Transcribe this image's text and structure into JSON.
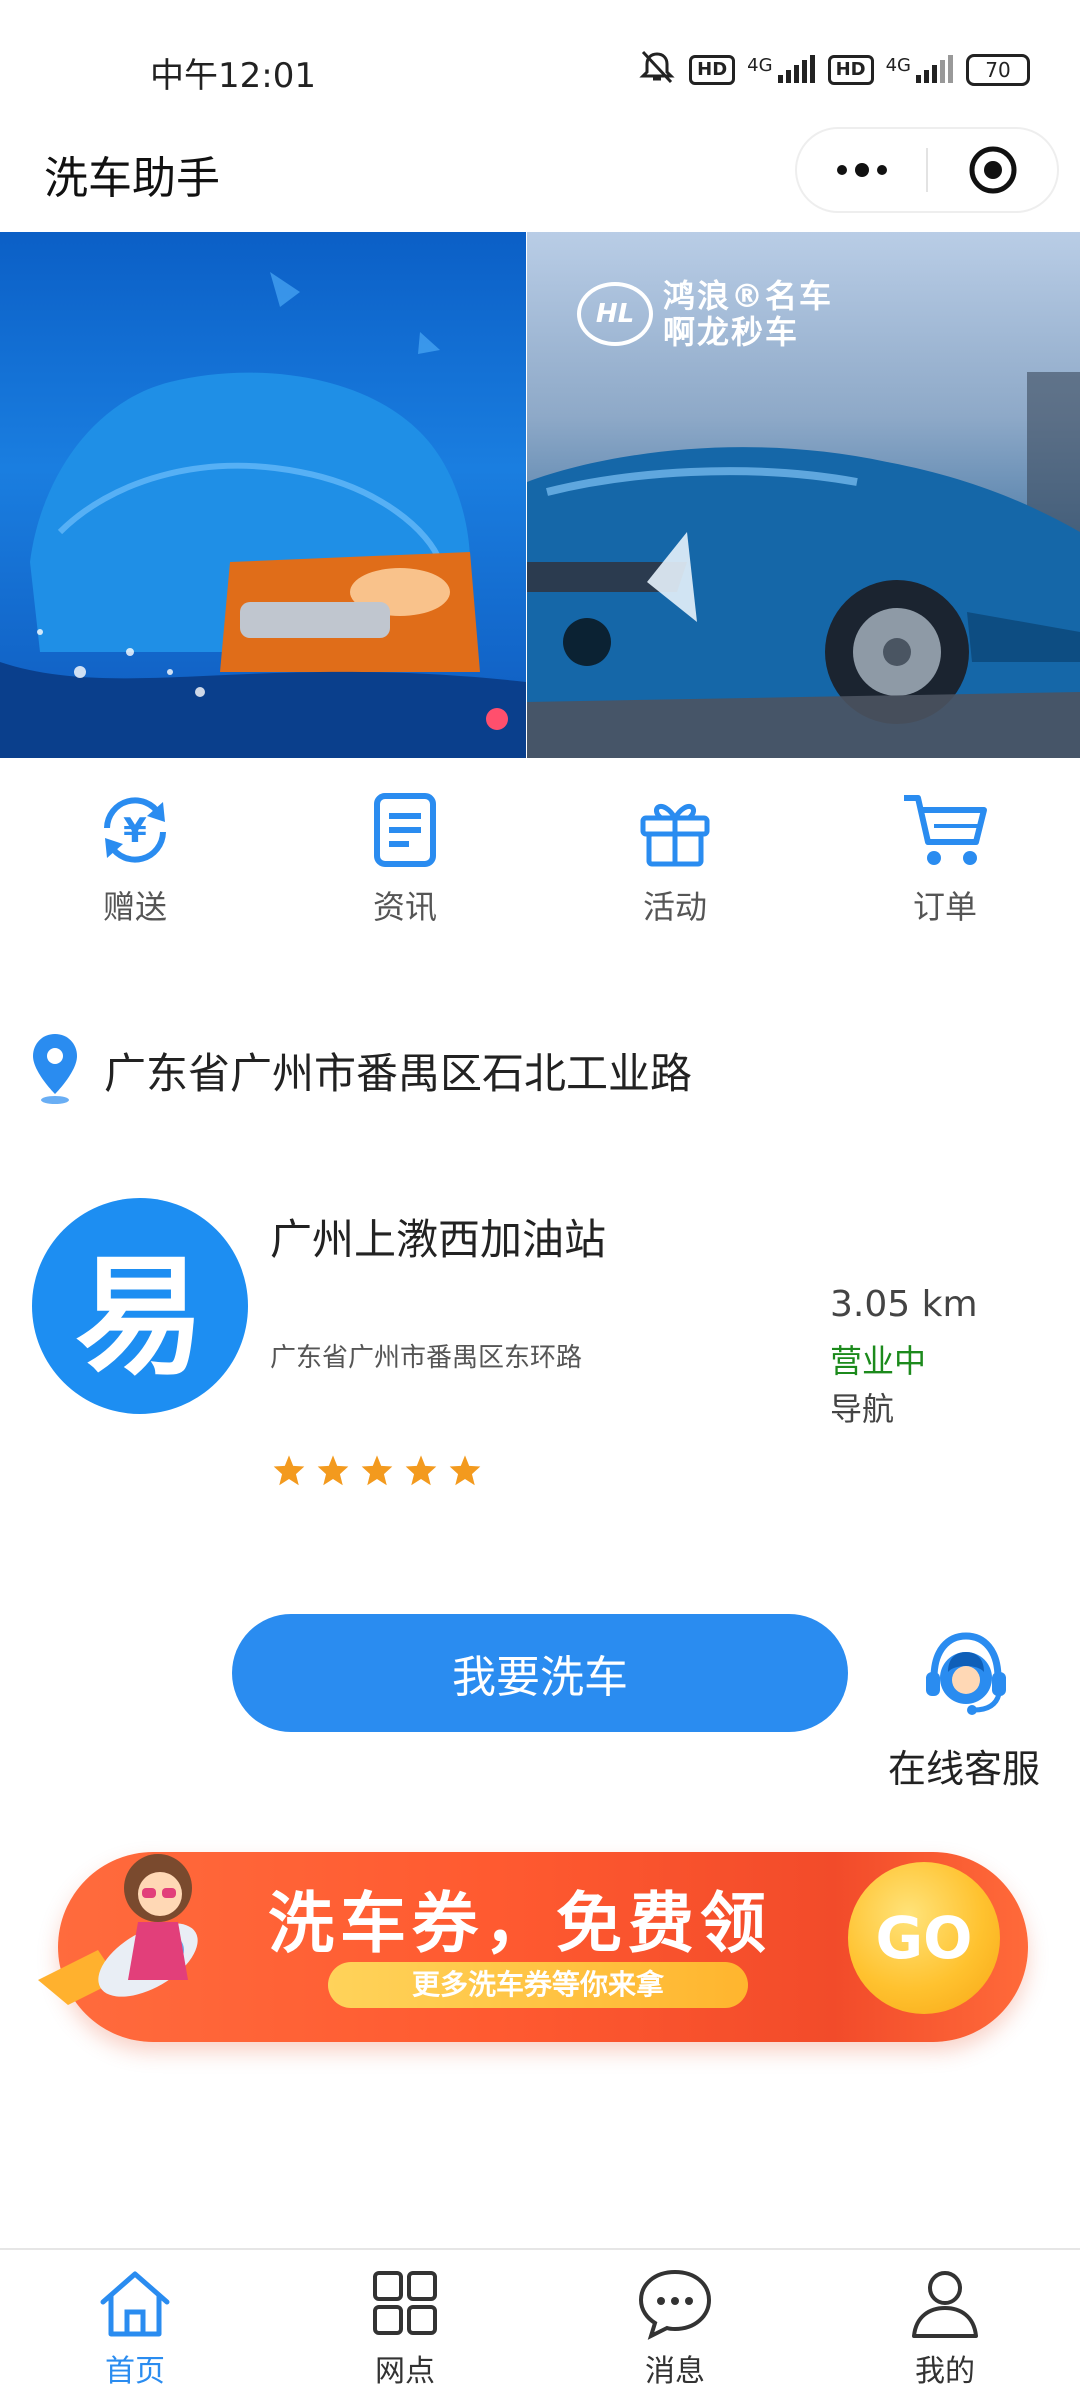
{
  "status_bar": {
    "time": "中午12:01",
    "hd1": "HD",
    "net1": "4G",
    "hd2": "HD",
    "net2": "4G",
    "battery": "70"
  },
  "navbar": {
    "title": "洗车助手"
  },
  "banner": {
    "brand_line1": "鸿浪®名车",
    "brand_line2": "啊龙秒车",
    "brand_initials": "HL"
  },
  "menu": {
    "items": [
      {
        "label": "赠送",
        "icon": "yuan-refresh-icon"
      },
      {
        "label": "资讯",
        "icon": "document-icon"
      },
      {
        "label": "活动",
        "icon": "gift-icon"
      },
      {
        "label": "订单",
        "icon": "cart-icon"
      }
    ]
  },
  "location": {
    "address": "广东省广州市番禺区石北工业路"
  },
  "station": {
    "logo_char": "易",
    "name": "广州上漖西加油站",
    "address": "广东省广州市番禺区东环路",
    "distance": "3.05 km",
    "status": "营业中",
    "navigate": "导航",
    "rating": 5
  },
  "actions": {
    "wash_button": "我要洗车",
    "customer_service": "在线客服"
  },
  "promo": {
    "title": "洗车券，免费领",
    "subtitle": "更多洗车券等你来拿",
    "go": "GO"
  },
  "tabbar": {
    "tabs": [
      {
        "label": "首页",
        "icon": "home-icon",
        "active": true
      },
      {
        "label": "网点",
        "icon": "grid-icon",
        "active": false
      },
      {
        "label": "消息",
        "icon": "chat-icon",
        "active": false
      },
      {
        "label": "我的",
        "icon": "user-icon",
        "active": false
      }
    ]
  },
  "colors": {
    "accent": "#2a8cf0",
    "open_status": "#1c8a1c",
    "star": "#f39a1e",
    "promo": "#ff5a30"
  }
}
